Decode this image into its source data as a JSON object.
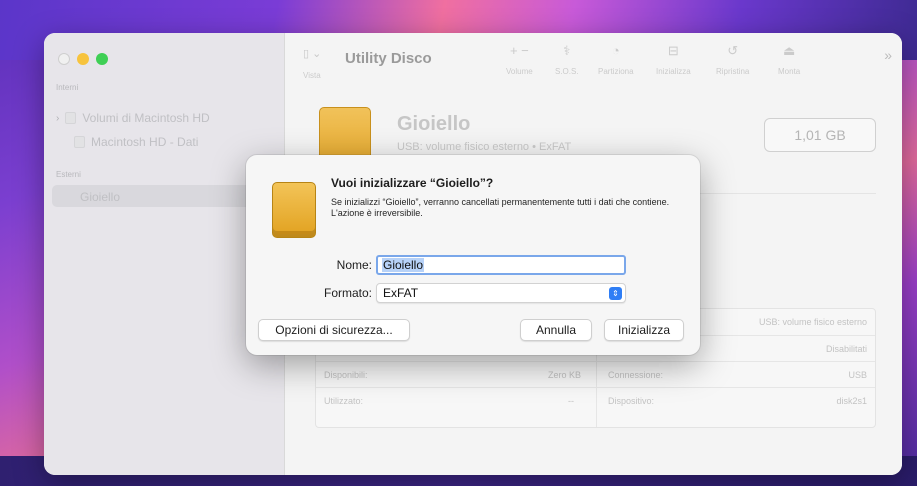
{
  "app": {
    "title": "Utility Disco",
    "view_label": "Vista"
  },
  "sidebar": {
    "section_internal": "Interni",
    "section_external": "Esterni",
    "items": [
      {
        "label": "Volumi di Macintosh HD"
      },
      {
        "label": "Macintosh HD - Dati"
      },
      {
        "label": "Gioiello"
      }
    ]
  },
  "toolbar": {
    "buttons": [
      {
        "label": "Volume",
        "icon": "plus-minus-icon"
      },
      {
        "label": "S.O.S.",
        "icon": "stethoscope-icon"
      },
      {
        "label": "Partiziona",
        "icon": "partition-icon"
      },
      {
        "label": "Inizializza",
        "icon": "erase-icon"
      },
      {
        "label": "Ripristina",
        "icon": "restore-icon"
      },
      {
        "label": "Monta",
        "icon": "mount-icon"
      }
    ]
  },
  "disk": {
    "name": "Gioiello",
    "subtitle": "USB: volume fisico esterno • ExFAT",
    "size": "1,01 GB"
  },
  "info": {
    "rows": [
      {
        "left_label": "",
        "left_value": "",
        "right_label": "",
        "right_value": "USB: volume fisico esterno"
      },
      {
        "left_label": "",
        "left_value": "",
        "right_label": "",
        "right_value": "Disabilitati"
      },
      {
        "left_label": "Disponibili:",
        "left_value": "Zero KB",
        "right_label": "Connessione:",
        "right_value": "USB"
      },
      {
        "left_label": "Utilizzato:",
        "left_value": "--",
        "right_label": "Dispositivo:",
        "right_value": "disk2s1"
      }
    ]
  },
  "dialog": {
    "title": "Vuoi inizializzare “Gioiello”?",
    "message": "Se inizializzi “Gioiello”, verranno cancellati permanentemente tutti i dati che contiene. L'azione è irreversibile.",
    "name_label": "Nome:",
    "name_value": "Gioiello",
    "format_label": "Formato:",
    "format_value": "ExFAT",
    "security_button": "Opzioni di sicurezza...",
    "cancel_button": "Annulla",
    "erase_button": "Inizializza"
  },
  "colors": {
    "disk_orange": "#e4a72a",
    "focus_blue": "#7aa7ea",
    "select_blue": "#2f7ef5"
  }
}
